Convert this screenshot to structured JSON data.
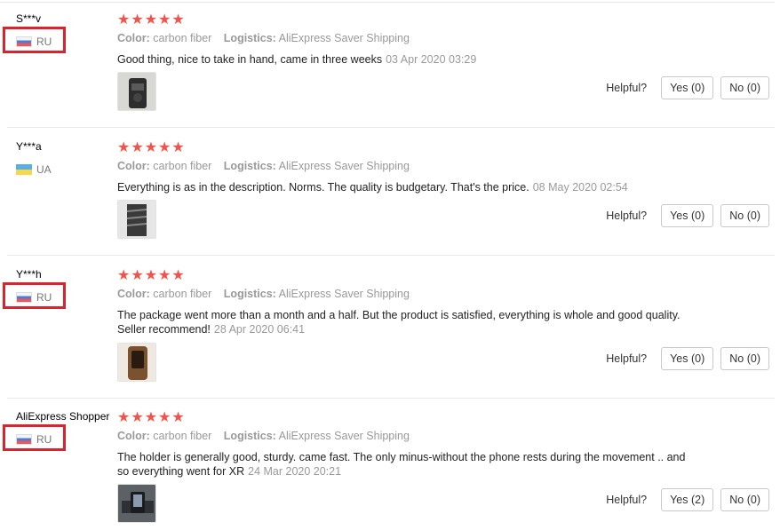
{
  "labels": {
    "color": "Color:",
    "logistics": "Logistics:",
    "helpful": "Helpful?"
  },
  "reviews": [
    {
      "user": "S***v",
      "country": "RU",
      "flag": "ru",
      "highlighted": true,
      "stars": 5,
      "color": "carbon fiber",
      "logistics": "AliExpress Saver Shipping",
      "text": "Good thing, nice to take in hand, came in three weeks",
      "date": "03 Apr 2020 03:29",
      "yes": "Yes (0)",
      "no": "No (0)",
      "photo": "phone-holder-photo"
    },
    {
      "user": "Y***a",
      "country": "UA",
      "flag": "ua",
      "highlighted": false,
      "stars": 5,
      "color": "carbon fiber",
      "logistics": "AliExpress Saver Shipping",
      "text": "Everything is as in the description. Norms. The quality is budgetary. That's the price.",
      "date": "08 May 2020 02:54",
      "yes": "Yes (0)",
      "no": "No (0)",
      "photo": "vent-mount-photo"
    },
    {
      "user": "Y***h",
      "country": "RU",
      "flag": "ru",
      "highlighted": true,
      "stars": 5,
      "color": "carbon fiber",
      "logistics": "AliExpress Saver Shipping",
      "text": "The package went more than a month and a half. But the product is satisfied, everything is whole and good quality. Seller recommend!",
      "date": "28 Apr 2020 06:41",
      "yes": "Yes (0)",
      "no": "No (0)",
      "photo": "mount-closeup-photo"
    },
    {
      "user": "AliExpress Shopper",
      "country": "RU",
      "flag": "ru",
      "highlighted": true,
      "stars": 5,
      "color": "carbon fiber",
      "logistics": "AliExpress Saver Shipping",
      "text": "The holder is generally good, sturdy. came fast. The only minus-without the phone rests during the movement .. and so everything went for XR",
      "date": "24 Mar 2020 20:21",
      "yes": "Yes (2)",
      "no": "No (0)",
      "photo": "car-interior-photo"
    }
  ],
  "colors": {
    "star": "#f2524a",
    "highlight": "#d9232d",
    "muted": "#999999"
  }
}
